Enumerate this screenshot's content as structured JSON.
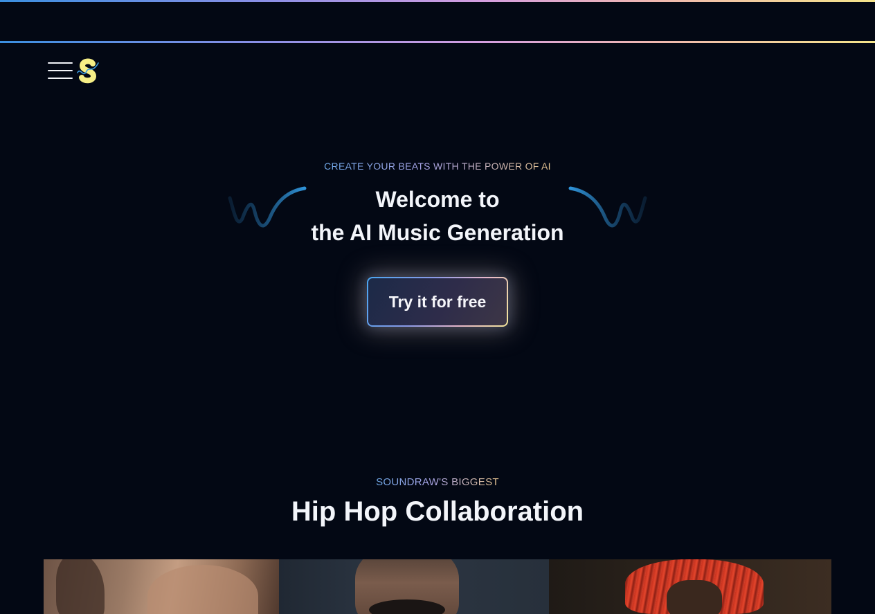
{
  "header": {
    "logo_alt": "Soundraw logo",
    "menu_icon": "hamburger-menu-icon"
  },
  "hero": {
    "eyebrow": "CREATE YOUR BEATS WITH THE POWER OF AI",
    "title_line1": "Welcome to",
    "title_line2": "the AI Music Generation",
    "cta_label": "Try it for free"
  },
  "collab": {
    "eyebrow": "SOUNDRAW'S BIGGEST",
    "title": "Hip Hop Collaboration"
  },
  "colors": {
    "background": "#030814",
    "accent_blue": "#3b8fe0",
    "accent_pink": "#d49ee0",
    "accent_yellow": "#f5e48a"
  }
}
